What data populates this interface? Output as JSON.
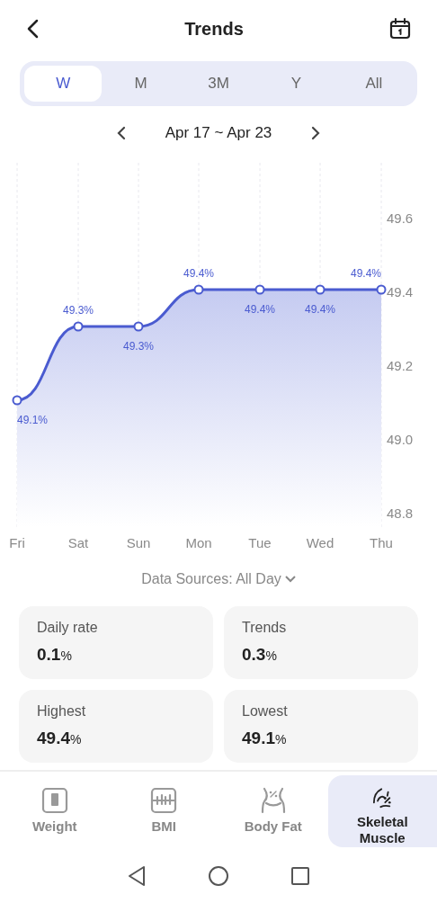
{
  "header": {
    "title": "Trends"
  },
  "periods": [
    {
      "label": "W",
      "selected": true
    },
    {
      "label": "M",
      "selected": false
    },
    {
      "label": "3M",
      "selected": false
    },
    {
      "label": "Y",
      "selected": false
    },
    {
      "label": "All",
      "selected": false
    }
  ],
  "date_range": "Apr 17 ~ Apr 23",
  "chart_data": {
    "type": "area",
    "grid": true,
    "categories": [
      "Fri",
      "Sat",
      "Sun",
      "Mon",
      "Tue",
      "Wed",
      "Thu"
    ],
    "series": [
      {
        "color": "#4a5bd0",
        "values": [
          49.1,
          49.3,
          49.3,
          49.4,
          49.4,
          49.4,
          49.4
        ]
      }
    ],
    "ylim": [
      48.756,
      49.744
    ],
    "yticks": [
      {
        "value": 48.8,
        "label": "48.8"
      },
      {
        "value": 49.0,
        "label": "49.0"
      },
      {
        "value": 49.2,
        "label": "49.2"
      },
      {
        "value": 49.4,
        "label": "49.4"
      },
      {
        "value": 49.6,
        "label": "49.6"
      }
    ],
    "value_labels": [
      "49.1%",
      "49.3%",
      "49.3%",
      "49.4%",
      "49.4%",
      "49.4%",
      "49.4%"
    ]
  },
  "data_sources": "Data Sources: All Day",
  "stats": [
    {
      "label": "Daily rate",
      "value": "0.1",
      "unit": "%"
    },
    {
      "label": "Trends",
      "value": "0.3",
      "unit": "%"
    },
    {
      "label": "Highest",
      "value": "49.4",
      "unit": "%"
    },
    {
      "label": "Lowest",
      "value": "49.1",
      "unit": "%"
    }
  ],
  "nav": [
    {
      "label": "Weight",
      "kind": "weight",
      "selected": false
    },
    {
      "label": "BMI",
      "kind": "bmi",
      "selected": false
    },
    {
      "label": "Body Fat",
      "kind": "bodyfat",
      "selected": false
    },
    {
      "label": "Skeletal Muscle",
      "kind": "muscle",
      "selected": true
    }
  ]
}
